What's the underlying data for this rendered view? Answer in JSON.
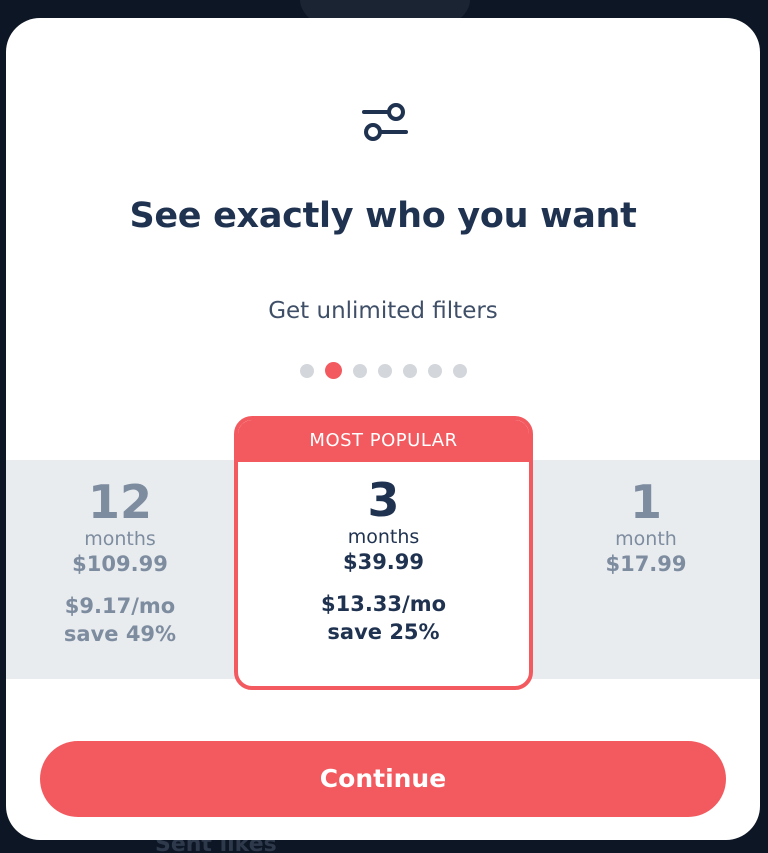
{
  "modal": {
    "title": "See exactly who you want",
    "subtitle": "Get unlimited filters",
    "pager": {
      "count": 7,
      "active_index": 1
    }
  },
  "plans": [
    {
      "duration": "12",
      "unit": "months",
      "price": "$109.99",
      "per_month": "$9.17/mo",
      "savings": "save 49%"
    },
    {
      "badge": "MOST POPULAR",
      "duration": "3",
      "unit": "months",
      "price": "$39.99",
      "per_month": "$13.33/mo",
      "savings": "save 25%"
    },
    {
      "duration": "1",
      "unit": "month",
      "price": "$17.99"
    }
  ],
  "continue_label": "Continue",
  "background": {
    "peek_text": "Sent likes"
  },
  "colors": {
    "accent": "#f25a5f",
    "navy": "#1f3250",
    "muted": "#7e8ca0",
    "band": "#e8ecef"
  },
  "icons": {
    "header": "filter-sliders-icon"
  }
}
